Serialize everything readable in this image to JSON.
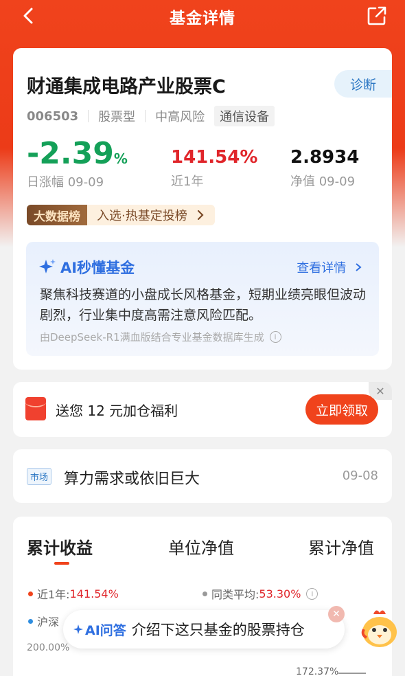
{
  "header": {
    "title": "基金详情"
  },
  "fund": {
    "name": "财通集成电路产业股票C",
    "diagnose_label": "诊断",
    "code": "006503",
    "type": "股票型",
    "risk": "中高风险",
    "sector": "通信设备"
  },
  "stats": {
    "daily_change_value": "-2.39",
    "daily_change_unit": "%",
    "daily_change_label": "日涨幅 09-09",
    "year_return_value": "141.54%",
    "year_return_label": "近1年",
    "nav_value": "2.8934",
    "nav_label": "净值 09-09"
  },
  "rank": {
    "badge": "大数据榜",
    "text": "入选·热基定投榜"
  },
  "ai": {
    "title": "AI秒懂基金",
    "link": "查看详情",
    "summary": "聚焦科技赛道的小盘成长风格基金，短期业绩亮眼但波动剧烈，行业集中度高需注意风险匹配。",
    "source": "由DeepSeek-R1满血版结合专业基金数据库生成"
  },
  "promo": {
    "text": "送您 12 元加仓福利",
    "button": "立即领取"
  },
  "news": {
    "tag": "市场",
    "headline": "算力需求或依旧巨大",
    "date": "09-08"
  },
  "chart_section": {
    "tabs": [
      "累计收益",
      "单位净值",
      "累计净值"
    ],
    "legend_fund_label": "近1年:",
    "legend_fund_value": "141.54%",
    "legend_peer_label": "同类平均:",
    "legend_peer_value": "53.30%",
    "legend_index_label": "沪深",
    "y_top": "200.00%",
    "current_marker": "172.37%"
  },
  "assistant": {
    "label": "AI问答",
    "prompt": "介绍下这只基金的股票持仓"
  },
  "colors": {
    "brand": "#f0431c",
    "down": "#14a058",
    "up": "#e0252a",
    "ai_blue": "#2f6fe0"
  }
}
